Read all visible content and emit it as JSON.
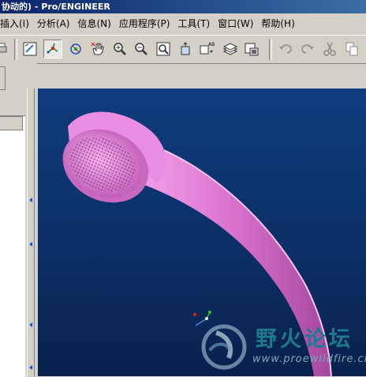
{
  "window": {
    "title": "协动的) - Pro/ENGINEER"
  },
  "menu": {
    "items": [
      {
        "label": "插入(I)"
      },
      {
        "label": "分析(A)"
      },
      {
        "label": "信息(N)"
      },
      {
        "label": "应用程序(P)"
      },
      {
        "label": "工具(T)"
      },
      {
        "label": "窗口(W)"
      },
      {
        "label": "帮助(H)"
      }
    ]
  },
  "toolbar": {
    "buttons": [
      {
        "icon": "print-icon"
      },
      {
        "icon": "repaint-icon"
      },
      {
        "icon": "spin-center-icon",
        "active": true
      },
      {
        "icon": "orient-mode-icon"
      },
      {
        "icon": "pan-hand-icon"
      },
      {
        "icon": "zoom-in-icon"
      },
      {
        "icon": "zoom-out-icon"
      },
      {
        "icon": "refit-icon"
      },
      {
        "icon": "reorient-icon"
      },
      {
        "icon": "saved-views-icon",
        "text": "AB"
      },
      {
        "icon": "layers-icon"
      },
      {
        "icon": "model-display-icon"
      },
      {
        "icon": "undo-icon"
      },
      {
        "icon": "redo-icon"
      },
      {
        "icon": "cut-icon"
      },
      {
        "icon": "copy-icon"
      }
    ]
  },
  "watermark": {
    "title": "野火论坛",
    "url": "www.proewildfire.cn"
  },
  "colors": {
    "viewport": "#0b2f66",
    "model": "#e07fd6",
    "titlebar": "#0a246a"
  }
}
